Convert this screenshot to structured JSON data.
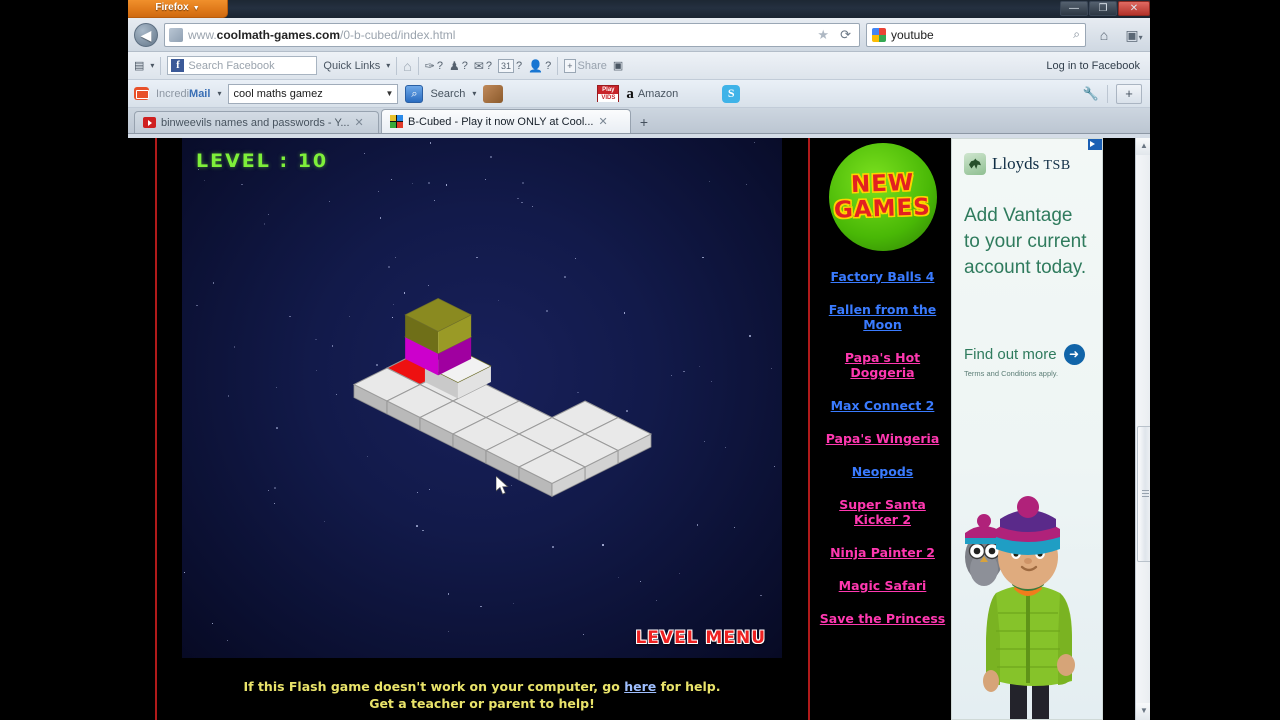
{
  "window": {
    "firefox_button": "Firefox",
    "minimize": "—",
    "restore": "❐",
    "close": "✕"
  },
  "navbar": {
    "back_icon": "◀",
    "url_prefix": "www.",
    "url_domain": "coolmath-games.com",
    "url_path": "/0-b-cubed/index.html",
    "star_icon": "★",
    "reload_icon": "⟳",
    "search_value": "youtube",
    "search_magnifier": "⌕",
    "home_icon": "⌂",
    "bookmarks_icon": "▣",
    "bookmarks_caret": "▾"
  },
  "facebook_toolbar": {
    "app_icon": "▤",
    "app_caret": "▾",
    "fb_logo_letter": "f",
    "search_placeholder": "Search Facebook",
    "quick_links": "Quick Links",
    "quick_links_caret": "▾",
    "home_icon": "⌂",
    "items": [
      {
        "icon": "✑",
        "count": "?"
      },
      {
        "icon": "♟",
        "count": "?"
      },
      {
        "icon": "✉",
        "count": "?"
      },
      {
        "icon": "31",
        "count": "?"
      },
      {
        "icon": "👤",
        "count": "?"
      }
    ],
    "share_plus": "+",
    "share_label": "Share",
    "camera_icon": "▣",
    "login_label": "Log in to Facebook"
  },
  "incredimail_toolbar": {
    "brand_prefix": "Incredi",
    "brand_suffix": "Mail",
    "brand_caret": "▾",
    "select_value": "cool maths gamez",
    "select_caret": "▼",
    "search_icon": "⌕",
    "search_label": "Search",
    "search_caret": "▾",
    "emoticon_name": "smiley-icon",
    "playvids_top": "Play",
    "playvids_bottom": "VIDS",
    "amazon_a": "a",
    "amazon_label": "Amazon",
    "skype_letter": "S",
    "wrench_icon": "🔧",
    "plus_icon": "+"
  },
  "tabs": [
    {
      "title": "binweevils names and passwords - Y...",
      "close": "✕",
      "active": false,
      "icon": "youtube-icon"
    },
    {
      "title": "B-Cubed - Play it now ONLY at Cool...",
      "close": "✕",
      "active": true,
      "icon": "bcubed-icon"
    }
  ],
  "new_tab_button": "+",
  "game": {
    "level_label": "LEVEL :  10",
    "level_menu": "LEVEL MENU",
    "help_line1_before": "If this Flash game doesn't work on your computer, go ",
    "help_link": "here",
    "help_line1_after": " for help.",
    "help_line2": "Get a teacher or parent to help!",
    "colors": {
      "player_top": "#8a8a20",
      "player_body": "#cc00cc",
      "goal_tile": "#ee1111",
      "tile": "#e9e9e9",
      "tile_edge": "#9a9a9a",
      "level_text": "#7ef03a",
      "menu_text": "#ee2222"
    }
  },
  "sidebar": {
    "logo_line1": "NEW",
    "logo_line2": "GAMES",
    "links": [
      {
        "label": "Factory Balls 4",
        "color": "#3a7bff"
      },
      {
        "label": "Fallen from the Moon",
        "color": "#3a7bff"
      },
      {
        "label": "Papa's Hot Doggeria",
        "color": "#ff38b0"
      },
      {
        "label": "Max Connect 2",
        "color": "#3a7bff"
      },
      {
        "label": "Papa's Wingeria",
        "color": "#ff38b0"
      },
      {
        "label": "Neopods",
        "color": "#3a7bff"
      },
      {
        "label": "Super Santa Kicker 2",
        "color": "#ff38b0"
      },
      {
        "label": "Ninja Painter 2",
        "color": "#ff38b0"
      },
      {
        "label": "Magic Safari",
        "color": "#ff38b0"
      },
      {
        "label": "Save the Princess",
        "color": "#ff38b0"
      }
    ]
  },
  "ad": {
    "adchoices_label": "AdChoices",
    "brand_name": "Lloyds",
    "brand_suffix": "TSB",
    "headline_line1": "Add Vantage",
    "headline_line2": "to your current",
    "headline_line3": "account today.",
    "cta": "Find out more",
    "cta_arrow": "➜",
    "terms": "Terms and Conditions apply.",
    "brand_color": "#2f7b5d",
    "character_name": "claymation-boy-with-owl"
  },
  "scrollbar": {
    "up_arrow": "▲",
    "down_arrow": "▼"
  }
}
